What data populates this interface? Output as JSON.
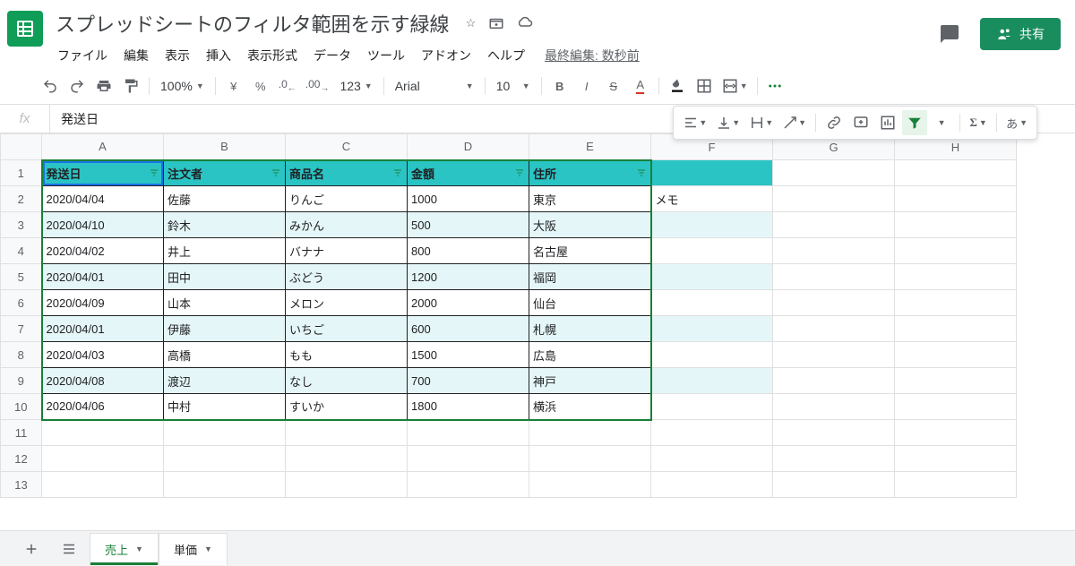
{
  "doc_title": "スプレッドシートのフィルタ範囲を示す緑線",
  "menus": [
    "ファイル",
    "編集",
    "表示",
    "挿入",
    "表示形式",
    "データ",
    "ツール",
    "アドオン",
    "ヘルプ"
  ],
  "last_edit": "最終編集: 数秒前",
  "share_label": "共有",
  "toolbar": {
    "zoom": "100%",
    "currency": "¥",
    "percent": "%",
    "dec_less": ".0",
    "dec_more": ".00",
    "format123": "123",
    "font": "Arial",
    "font_size": "10",
    "bold": "B",
    "italic": "I",
    "strike": "S",
    "text_color": "A",
    "input_lang": "あ"
  },
  "formula_value": "発送日",
  "columns": [
    "A",
    "B",
    "C",
    "D",
    "E",
    "F",
    "G",
    "H"
  ],
  "row_count": 13,
  "headers": [
    "発送日",
    "注文者",
    "商品名",
    "金額",
    "住所"
  ],
  "extra_col_f_header": "",
  "rows": [
    {
      "date": "2020/04/04",
      "name": "佐藤",
      "item": "りんご",
      "amount": "1000",
      "addr": "東京",
      "memo": "メモ"
    },
    {
      "date": "2020/04/10",
      "name": "鈴木",
      "item": "みかん",
      "amount": "500",
      "addr": "大阪",
      "memo": ""
    },
    {
      "date": "2020/04/02",
      "name": "井上",
      "item": "バナナ",
      "amount": "800",
      "addr": "名古屋",
      "memo": ""
    },
    {
      "date": "2020/04/01",
      "name": "田中",
      "item": "ぶどう",
      "amount": "1200",
      "addr": "福岡",
      "memo": ""
    },
    {
      "date": "2020/04/09",
      "name": "山本",
      "item": "メロン",
      "amount": "2000",
      "addr": "仙台",
      "memo": ""
    },
    {
      "date": "2020/04/01",
      "name": "伊藤",
      "item": "いちご",
      "amount": "600",
      "addr": "札幌",
      "memo": ""
    },
    {
      "date": "2020/04/03",
      "name": "高橋",
      "item": "もも",
      "amount": "1500",
      "addr": "広島",
      "memo": ""
    },
    {
      "date": "2020/04/08",
      "name": "渡辺",
      "item": "なし",
      "amount": "700",
      "addr": "神戸",
      "memo": ""
    },
    {
      "date": "2020/04/06",
      "name": "中村",
      "item": "すいか",
      "amount": "1800",
      "addr": "横浜",
      "memo": ""
    }
  ],
  "sheet_tabs": [
    {
      "name": "売上",
      "active": true
    },
    {
      "name": "単価",
      "active": false
    }
  ]
}
